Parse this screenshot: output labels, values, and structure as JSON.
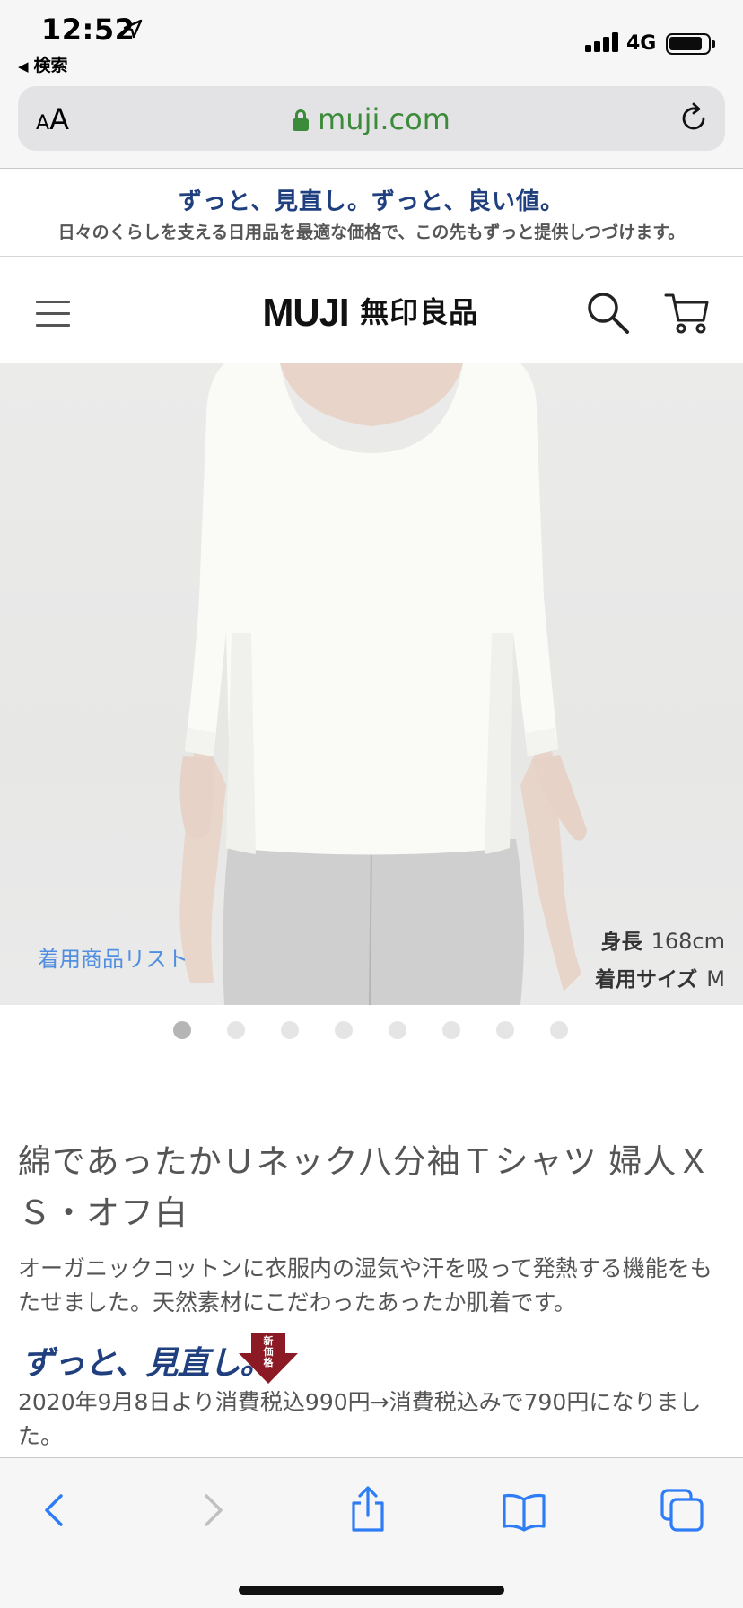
{
  "status_bar": {
    "time": "12:52",
    "back_label": "検索",
    "network": "4G"
  },
  "browser": {
    "text_size_label_small": "A",
    "text_size_label_big": "A",
    "url": "muji.com"
  },
  "promo": {
    "title": "ずっと、見直し。ずっと、良い値。",
    "subtitle": "日々のくらしを支える日用品を最適な価格で、この先もずっと提供しつづけます。"
  },
  "site_header": {
    "logo_en": "MUJI",
    "logo_jp": "無印良品"
  },
  "product_image": {
    "caption_left": "着用商品リスト",
    "height_label": "身長",
    "height_value": "168cm",
    "size_label": "着用サイズ",
    "size_value": "M",
    "slide_count": 8,
    "active_slide": 1
  },
  "product": {
    "title": "綿であったかＵネック八分袖Ｔシャツ 婦人ＸＳ・オフ白",
    "description": "オーガニックコットンに衣服内の湿気や汗を吸って発熱する機能をもたせました。天然素材にこだわったあったか肌着です。",
    "badge_text": "ずっと、見直し。",
    "badge_arrow_text": "新価格",
    "price_note": "2020年9月8日より消費税込990円→消費税込みで790円になりました。"
  },
  "colors": {
    "accent_navy": "#1f3f7e",
    "url_green": "#3c8b3a",
    "link_blue": "#4f8ee0",
    "badge_red": "#8b1a24"
  },
  "icons": [
    "location-arrow-icon",
    "signal-icon",
    "battery-icon",
    "lock-icon",
    "reload-icon",
    "hamburger-icon",
    "search-icon",
    "cart-icon",
    "back-icon",
    "forward-icon",
    "share-icon",
    "bookmarks-icon",
    "tabs-icon"
  ]
}
